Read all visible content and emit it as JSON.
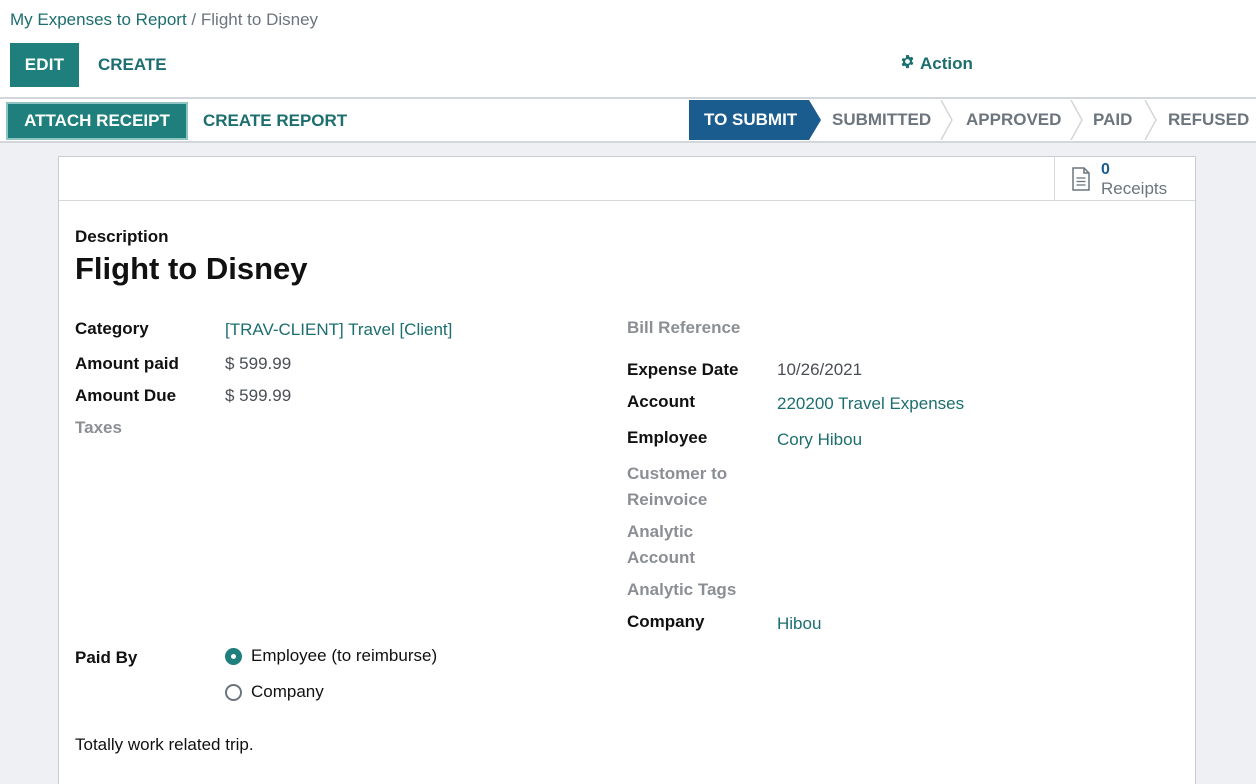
{
  "breadcrumb": {
    "parent": "My Expenses to Report",
    "separator": " / ",
    "current": "Flight to Disney"
  },
  "toolbar": {
    "edit_label": "EDIT",
    "create_label": "CREATE",
    "action_label": "Action"
  },
  "statusbar": {
    "attach_receipt_label": "ATTACH RECEIPT",
    "create_report_label": "CREATE REPORT",
    "stages": [
      "TO SUBMIT",
      "SUBMITTED",
      "APPROVED",
      "PAID",
      "REFUSED"
    ],
    "active_stage": "TO SUBMIT"
  },
  "smart_button": {
    "count": "0",
    "label": "Receipts",
    "icon": "document-icon"
  },
  "form": {
    "description_label": "Description",
    "title": "Flight to Disney",
    "left": {
      "category_label": "Category",
      "category_value": "[TRAV-CLIENT] Travel [Client]",
      "amount_paid_label": "Amount paid",
      "amount_paid_value": "$ 599.99",
      "amount_due_label": "Amount Due",
      "amount_due_value": "$ 599.99",
      "taxes_label": "Taxes"
    },
    "right": {
      "bill_reference_label": "Bill Reference",
      "expense_date_label": "Expense Date",
      "expense_date_value": "10/26/2021",
      "account_label": "Account",
      "account_value": "220200 Travel Expenses",
      "employee_label": "Employee",
      "employee_value": "Cory Hibou",
      "customer_label_1": "Customer to",
      "customer_label_2": "Reinvoice",
      "analytic_account_label_1": "Analytic",
      "analytic_account_label_2": "Account",
      "analytic_tags_label": "Analytic Tags",
      "company_label": "Company",
      "company_value": "Hibou"
    },
    "paid_by": {
      "label": "Paid By",
      "options": [
        "Employee (to reimburse)",
        "Company"
      ],
      "selected": "Employee (to reimburse)"
    },
    "note": "Totally work related trip."
  },
  "colors": {
    "primary_teal": "#1f7f7c",
    "link_teal": "#1c6e6f",
    "active_stage_blue": "#1b5c8f"
  }
}
